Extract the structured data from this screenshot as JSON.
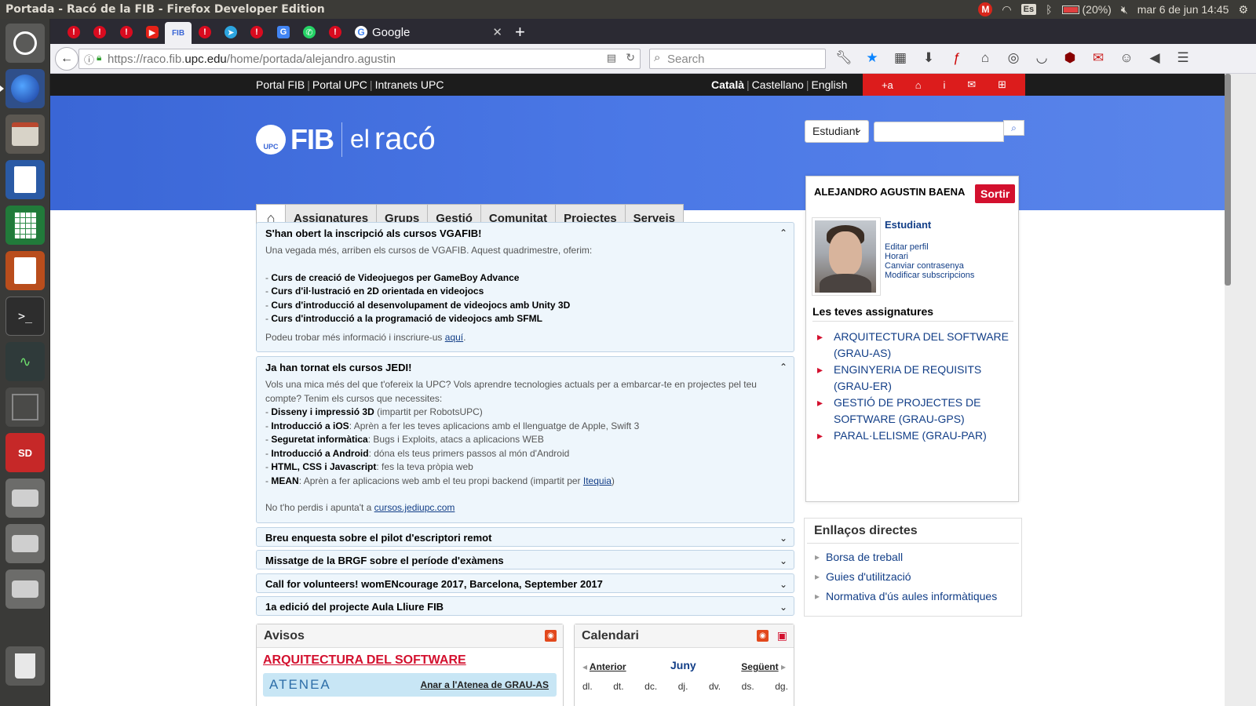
{
  "os": {
    "window_title": "Portada - Racó de la FIB - Firefox Developer Edition",
    "keyboard": "Es",
    "battery": "(20%)",
    "datetime": "mar  6 de jun 14:45"
  },
  "browser": {
    "tab_active_title": "Google",
    "url_prefix": "https://raco.fib.",
    "url_host": "upc.edu",
    "url_path": "/home/portada/alejandro.agustin",
    "search_placeholder": "Search"
  },
  "page": {
    "top_links": [
      "Portal FIB",
      "Portal UPC",
      "Intranets UPC"
    ],
    "languages": [
      "Català",
      "Castellano",
      "English"
    ],
    "red_strip": [
      "+a",
      "⌂",
      "i",
      "✉",
      "⊞"
    ],
    "logo_fib": "FIB",
    "logo_el": "el",
    "logo_raco": "racó",
    "logo_upc": "UPC",
    "role_select": "Estudiant",
    "nav": [
      "Assignatures",
      "Grups",
      "Gestió",
      "Comunitat",
      "Projectes",
      "Serveis"
    ]
  },
  "news": {
    "vgafib": {
      "title": "S'han obert la inscripció als cursos VGAFIB!",
      "intro": "Una vegada més, arriben els cursos de VGAFIB. Aquest quadrimestre, oferim:",
      "items": [
        "Curs de creació de Videojuegos per GameBoy Advance",
        "Curs d'il·lustració en 2D orientada en videojocs",
        "Curs d'introducció al desenvolupament de videojocs amb Unity 3D",
        "Curs d'introducció a la programació de videojocs amb SFML"
      ],
      "footer": "Podeu trobar més informació i inscriure-us ",
      "link": "aquí"
    },
    "jedi": {
      "title": "Ja han tornat els cursos JEDI!",
      "intro": "Vols una mica més del que t'ofereix la UPC? Vols aprendre tecnologies actuals per a embarcar-te en projectes pel teu compte? Tenim els cursos que necessites:",
      "items": [
        {
          "b": "Disseny i impressió 3D",
          "t": " (impartit per RobotsUPC)"
        },
        {
          "b": "Introducció a iOS",
          "t": ": Aprèn a fer les teves aplicacions amb el llenguatge de Apple, Swift 3"
        },
        {
          "b": "Seguretat informàtica",
          "t": ": Bugs i Exploits, atacs a aplicacions WEB"
        },
        {
          "b": "Introducció a Android",
          "t": ": dóna els teus primers passos al món d'Android"
        },
        {
          "b": "HTML, CSS i Javascript",
          "t": ": fes la teva pròpia web"
        },
        {
          "b": "MEAN",
          "t": ": Aprèn a fer aplicacions web amb el teu propi backend (impartit per ",
          "link": "Itequia",
          "end": ")"
        }
      ],
      "footer": "No t'ho perdis i apunta't a ",
      "link": "cursos.jediupc.com"
    },
    "collapsed": [
      "Breu enquesta sobre el pilot d'escriptori remot",
      "Missatge de la BRGF sobre el període d'exàmens",
      "Call for volunteers! womENcourage 2017, Barcelona, September 2017",
      "1a edició del projecte Aula Lliure FIB"
    ]
  },
  "avisos": {
    "title": "Avisos",
    "subject": "ARQUITECTURA DEL SOFTWARE",
    "atenea": "ATENEA",
    "atenea_link": "Anar a l'Atenea de GRAU-AS"
  },
  "calendari": {
    "title": "Calendari",
    "prev": "Anterior",
    "month": "Juny",
    "next": "Següent",
    "days": [
      "dl.",
      "dt.",
      "dc.",
      "dj.",
      "dv.",
      "ds.",
      "dg."
    ]
  },
  "user": {
    "name": "ALEJANDRO AGUSTIN BAENA",
    "logout": "Sortir",
    "role": "Estudiant",
    "links": [
      "Editar perfil",
      "Horari",
      "Canviar contrasenya",
      "Modificar subscripcions"
    ],
    "subjects_title": "Les teves assignatures",
    "subjects": [
      "ARQUITECTURA DEL SOFTWARE (GRAU-AS)",
      "ENGINYERIA DE REQUISITS (GRAU-ER)",
      "GESTIÓ DE PROJECTES DE SOFTWARE (GRAU-GPS)",
      "PARAL·LELISME (GRAU-PAR)"
    ]
  },
  "enllacos": {
    "title": "Enllaços directes",
    "items": [
      "Borsa de treball",
      "Guies d'utilització",
      "Normativa d'ús aules informàtiques"
    ]
  }
}
